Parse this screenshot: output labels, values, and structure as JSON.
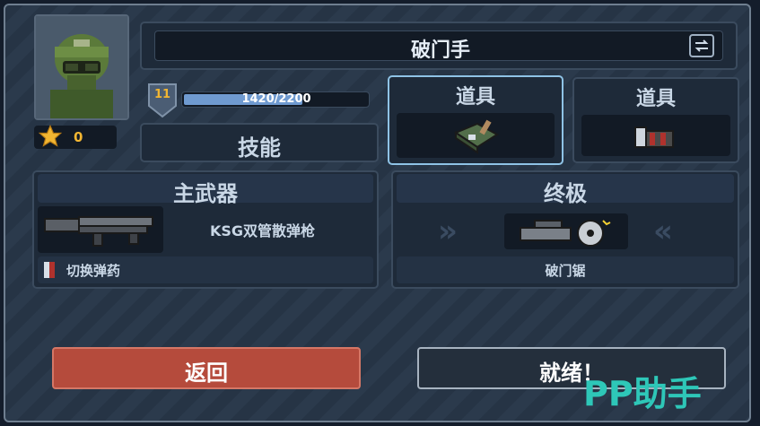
{
  "character": {
    "name": "破门手",
    "stars": "0"
  },
  "level": {
    "value": "11",
    "xp_text": "1420/2200",
    "xp_progress": 0.645
  },
  "skills": {
    "label": "技能"
  },
  "items": [
    {
      "label": "道具"
    },
    {
      "label": "道具"
    }
  ],
  "primary": {
    "header": "主武器",
    "weapon_name": "KSG双管散弹枪",
    "ability": "切换弹药"
  },
  "ultimate": {
    "header": "终极",
    "name": "破门锯"
  },
  "buttons": {
    "back": "返回",
    "ready": "就绪！"
  },
  "watermark": "PP助手",
  "colors": {
    "back": "#b54b3c",
    "accent": "#4fb9e8",
    "star": "#f2b632",
    "watermark": "#2ec7b8"
  }
}
